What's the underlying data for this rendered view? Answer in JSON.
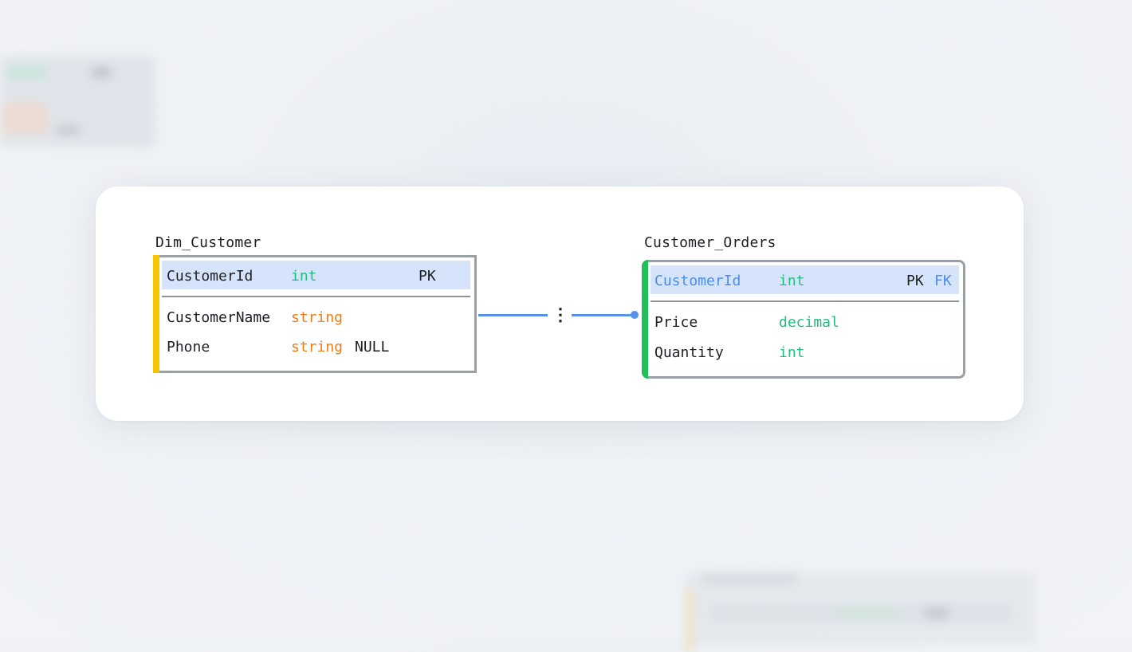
{
  "colors": {
    "int": "#1fbf7e",
    "string": "#f07b17",
    "decimal": "#1fbf7e",
    "foreign_key": "#4a8de9",
    "relation_line": "#5592ee",
    "dim_accent": "#f6c400",
    "fact_accent": "#1fbf5a",
    "pk_highlight": "#d6e4fb"
  },
  "tables": [
    {
      "name": "Dim_Customer",
      "accent": "yellow",
      "key_column": {
        "name": "CustomerId",
        "type": "int",
        "flags": "PK"
      },
      "columns": [
        {
          "name": "CustomerName",
          "type": "string",
          "nullable": ""
        },
        {
          "name": "Phone",
          "type": "string",
          "nullable": "NULL"
        }
      ]
    },
    {
      "name": "Customer_Orders",
      "accent": "green",
      "key_column": {
        "name": "CustomerId",
        "type": "int",
        "flags": "PK",
        "fk": "FK"
      },
      "columns": [
        {
          "name": "Price",
          "type": "decimal"
        },
        {
          "name": "Quantity",
          "type": "int"
        }
      ]
    }
  ],
  "relationship": {
    "from": "Dim_Customer",
    "to": "Customer_Orders",
    "marker": "⋮"
  }
}
